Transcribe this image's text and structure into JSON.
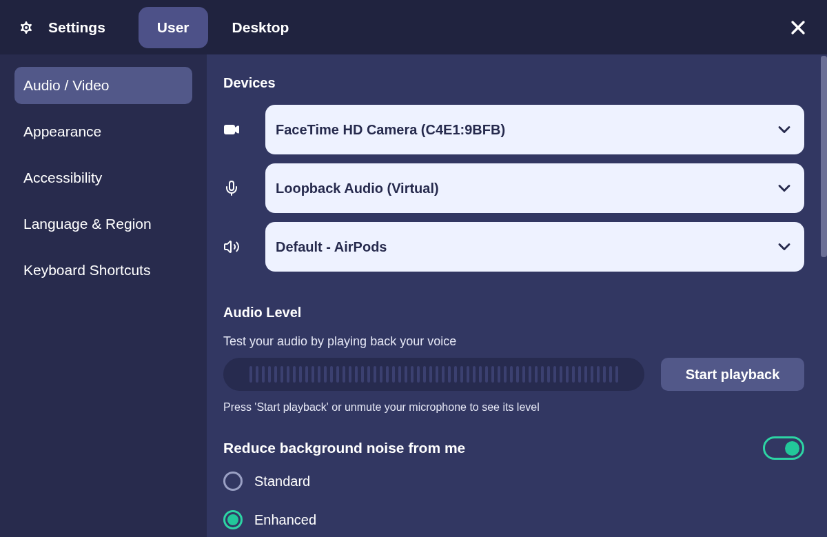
{
  "header": {
    "title": "Settings",
    "tabs": [
      {
        "label": "User",
        "selected": true
      },
      {
        "label": "Desktop",
        "selected": false
      }
    ]
  },
  "sidebar": {
    "items": [
      {
        "label": "Audio / Video",
        "selected": true
      },
      {
        "label": "Appearance",
        "selected": false
      },
      {
        "label": "Accessibility",
        "selected": false
      },
      {
        "label": "Language & Region",
        "selected": false
      },
      {
        "label": "Keyboard Shortcuts",
        "selected": false
      }
    ]
  },
  "devices": {
    "title": "Devices",
    "items": [
      {
        "kind": "camera",
        "value": "FaceTime HD Camera (C4E1:9BFB)"
      },
      {
        "kind": "microphone",
        "value": "Loopback Audio (Virtual)"
      },
      {
        "kind": "speaker",
        "value": "Default - AirPods"
      }
    ]
  },
  "audio_level": {
    "title": "Audio Level",
    "subtitle": "Test your audio by playing back your voice",
    "button": "Start playback",
    "hint": "Press 'Start playback' or unmute your microphone to see its level"
  },
  "noise": {
    "title": "Reduce background noise from me",
    "on": true,
    "options": [
      {
        "label": "Standard",
        "selected": false
      },
      {
        "label": "Enhanced",
        "selected": true
      }
    ]
  }
}
